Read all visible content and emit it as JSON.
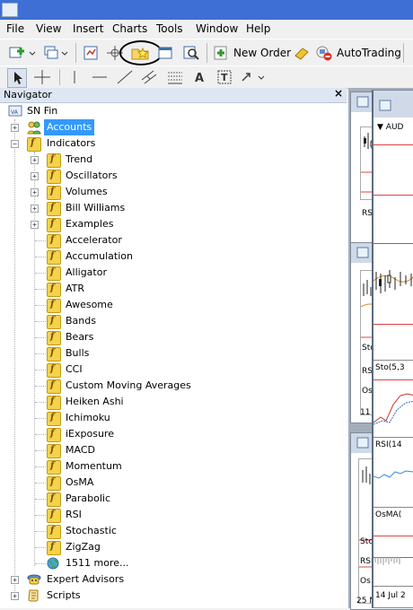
{
  "menu": [
    "File",
    "View",
    "Insert",
    "Charts",
    "Tools",
    "Window",
    "Help"
  ],
  "toolbar": {
    "new_order": "New Order",
    "autotrading": "AutoTrading"
  },
  "navigator": {
    "title": "Navigator",
    "close": "×",
    "root": "SN Fin",
    "accounts": "Accounts",
    "indicators": "Indicators",
    "folders": [
      "Trend",
      "Oscillators",
      "Volumes",
      "Bill Williams",
      "Examples"
    ],
    "items": [
      "Accelerator",
      "Accumulation",
      "Alligator",
      "ATR",
      "Awesome",
      "Bands",
      "Bears",
      "Bulls",
      "CCI",
      "Custom Moving Averages",
      "Heiken Ashi",
      "Ichimoku",
      "iExposure",
      "MACD",
      "Momentum",
      "OsMA",
      "Parabolic",
      "RSI",
      "Stochastic",
      "ZigZag"
    ],
    "more": "1511 more...",
    "expert_advisors": "Expert Advisors",
    "scripts": "Scripts"
  },
  "charts": {
    "c1_symbol": "AUD",
    "c2_rsi": "RSI",
    "c2_sto": "Sto",
    "c2_rs": "RS",
    "c2_os": "Os",
    "c2_date": "11",
    "c3_sto": "Sto(5,3",
    "c3_rsi": "RSI(14",
    "c3_osma": "OsMA(",
    "c3_date": "14 Jul 2",
    "c4_sto": "Sto",
    "c4_rsi": "RSI",
    "c4_os": "Os",
    "c4_date": "25 N"
  },
  "colors": {
    "title_bar": "#3d6fd4",
    "selection": "#3399ff",
    "highlight_ring": "#000000"
  }
}
